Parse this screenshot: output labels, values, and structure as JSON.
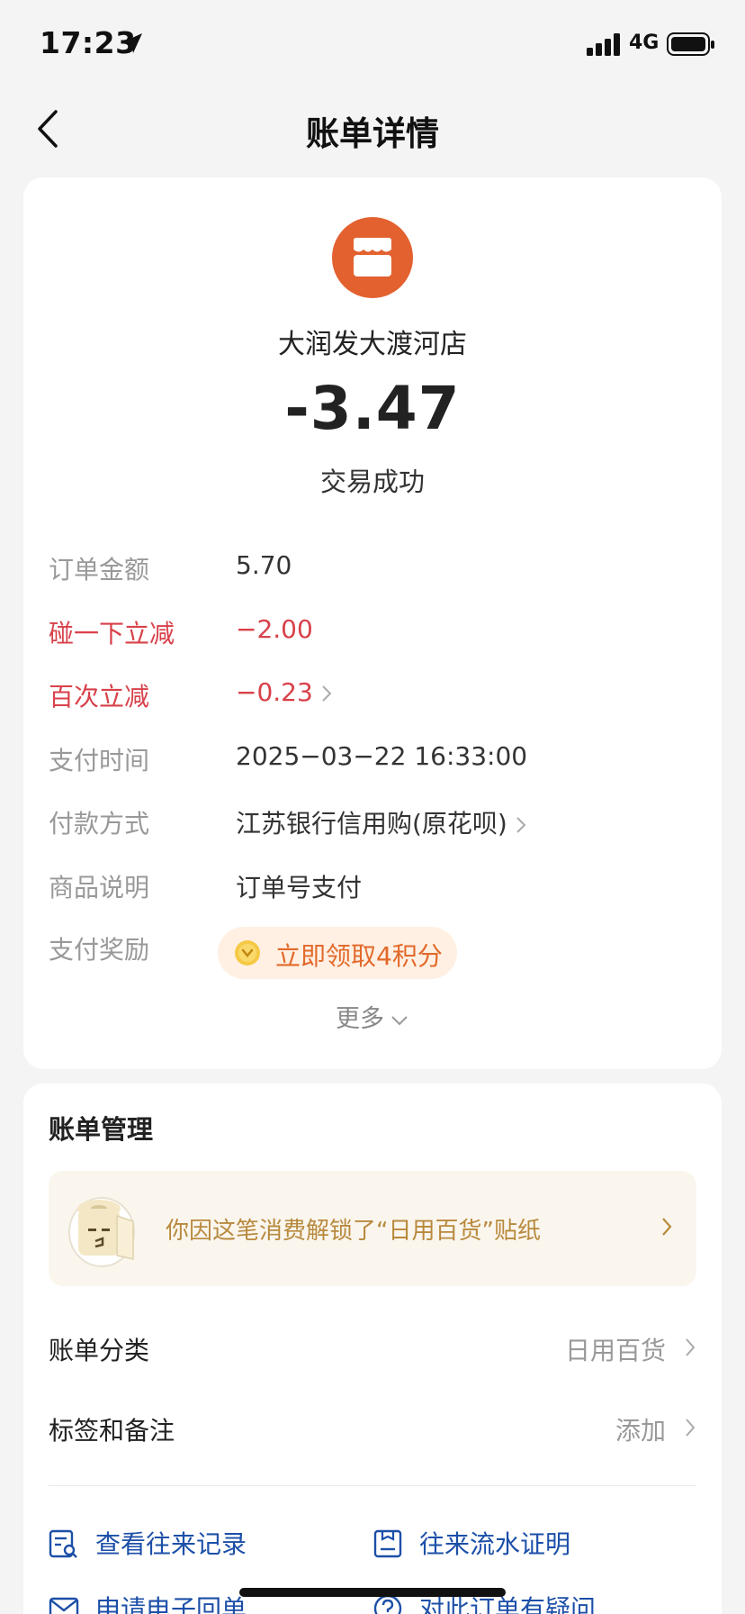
{
  "status_bar": {
    "time": "17:23",
    "network": "4G"
  },
  "nav": {
    "title": "账单详情"
  },
  "bill": {
    "merchant": "大润发大渡河店",
    "amount": "-3.47",
    "status": "交易成功",
    "rows": [
      {
        "label": "订单金额",
        "value": "5.70"
      },
      {
        "label": "碰一下立减",
        "value": "−2.00"
      },
      {
        "label": "百次立减",
        "value": "−0.23"
      },
      {
        "label": "支付时间",
        "value": "2025−03−22 16:33:00"
      },
      {
        "label": "付款方式",
        "value": "江苏银行信用购(原花呗)"
      },
      {
        "label": "商品说明",
        "value": "订单号支付"
      },
      {
        "label": "支付奖励",
        "value": ""
      }
    ],
    "reward_label": "立即领取4积分",
    "more_label": "更多"
  },
  "management": {
    "title": "账单管理",
    "banner_text": "你因这笔消费解锁了“日用百货”贴纸",
    "category": {
      "label": "账单分类",
      "value": "日用百货"
    },
    "tags": {
      "label": "标签和备注",
      "value": "添加"
    },
    "links": [
      {
        "label": "查看往来记录"
      },
      {
        "label": "往来流水证明"
      },
      {
        "label": "申请电子回单"
      },
      {
        "label": "对此订单有疑问"
      }
    ]
  },
  "colors": {
    "accent": "#e2612f",
    "discount_red": "#d8414a",
    "link_blue": "#1c4fa8",
    "reward_orange": "#e2692a"
  }
}
